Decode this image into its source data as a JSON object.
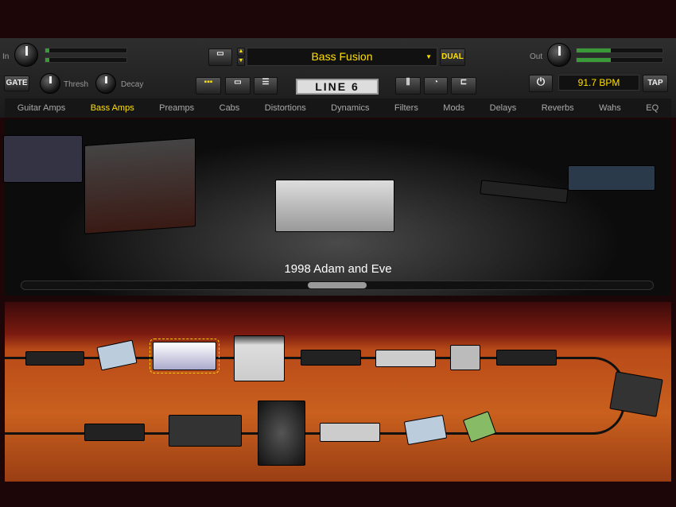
{
  "top": {
    "in_label": "In",
    "out_label": "Out",
    "preset_name": "Bass Fusion",
    "dual_label": "DUAL",
    "gate_label": "GATE",
    "thresh_label": "Thresh",
    "decay_label": "Decay",
    "bpm": "91.7 BPM",
    "tap_label": "TAP",
    "logo": "LINE 6"
  },
  "meters": {
    "in_level": 0.05,
    "out_level": 0.4
  },
  "tabs": [
    {
      "label": "Guitar Amps"
    },
    {
      "label": "Bass Amps",
      "active": true
    },
    {
      "label": "Preamps"
    },
    {
      "label": "Cabs"
    },
    {
      "label": "Distortions"
    },
    {
      "label": "Dynamics"
    },
    {
      "label": "Filters"
    },
    {
      "label": "Mods"
    },
    {
      "label": "Delays"
    },
    {
      "label": "Reverbs"
    },
    {
      "label": "Wahs"
    },
    {
      "label": "EQ"
    }
  ],
  "browser": {
    "selected_model": "1998 Adam and Eve"
  },
  "colors": {
    "accent": "#ffe000",
    "wood": "#c9601e"
  }
}
